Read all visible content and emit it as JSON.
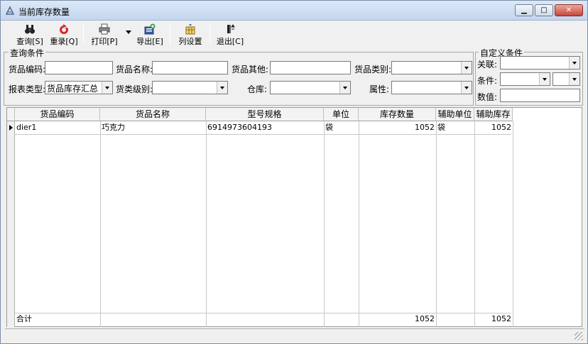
{
  "window": {
    "title": "当前库存数量"
  },
  "toolbar": {
    "query": "查询[S]",
    "reset": "重录[Q]",
    "print": "打印[P]",
    "export": "导出[E]",
    "column_settings": "列设置",
    "exit": "退出[C]"
  },
  "query_panel": {
    "legend": "查询条件",
    "item_code_label": "货品编码:",
    "item_code_value": "",
    "item_name_label": "货品名称:",
    "item_name_value": "",
    "item_other_label": "货品其他:",
    "item_other_value": "",
    "item_category_label": "货品类别:",
    "item_category_value": "",
    "report_type_label": "报表类型:",
    "report_type_value": "货品库存汇总",
    "item_level_label": "货类级别:",
    "item_level_value": "",
    "warehouse_label": "仓库:",
    "warehouse_value": "",
    "attribute_label": "属性:",
    "attribute_value": ""
  },
  "custom_panel": {
    "legend": "自定义条件",
    "relation_label": "关联:",
    "condition_label": "条件:",
    "value_label": "数值:"
  },
  "grid": {
    "headers": [
      "货品编码",
      "货品名称",
      "型号规格",
      "单位",
      "库存数量",
      "辅助单位",
      "辅助库存"
    ],
    "rows": [
      {
        "code": "dier1",
        "name": "巧克力",
        "spec": "6914973604193",
        "unit": "袋",
        "qty": "1052",
        "aux_unit": "袋",
        "aux_qty": "1052"
      }
    ],
    "footer": {
      "label": "合计",
      "qty": "1052",
      "aux_qty": "1052"
    }
  }
}
